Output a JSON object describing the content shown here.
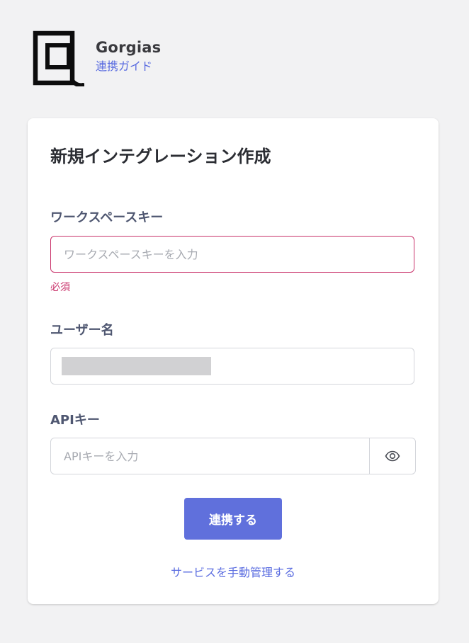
{
  "header": {
    "brand_name": "Gorgias",
    "guide_link": "連携ガイド",
    "logo_icon": "gorgias-logo"
  },
  "card": {
    "title": "新規インテグレーション作成",
    "workspace": {
      "label": "ワークスペースキー",
      "placeholder": "ワークスペースキーを入力",
      "value": "",
      "error": "必須"
    },
    "username": {
      "label": "ユーザー名",
      "value_masked": true
    },
    "api_key": {
      "label": "APIキー",
      "placeholder": "APIキーを入力",
      "value": "",
      "toggle_icon": "eye-icon"
    },
    "connect_button": "連携する",
    "manual_link": "サービスを手動管理する"
  },
  "colors": {
    "accent": "#6070dc",
    "link": "#5a6ce0",
    "error": "#c9336b",
    "label": "#4f5771",
    "background": "#f2f2f3"
  }
}
